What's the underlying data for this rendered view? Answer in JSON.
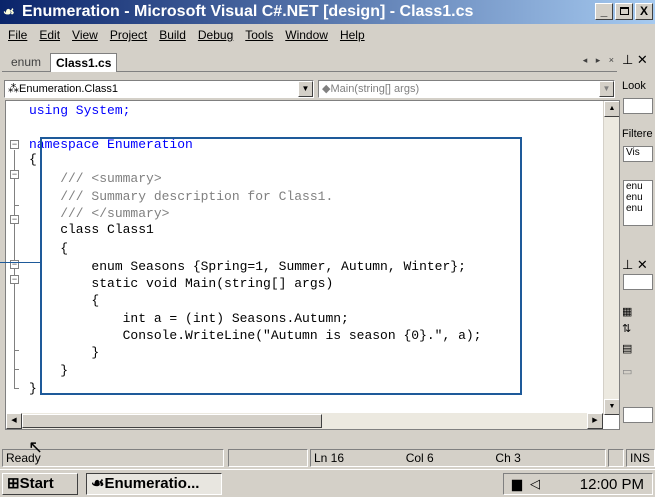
{
  "window": {
    "title": "Enumeration - Microsoft Visual C#.NET [design] - Class1.cs",
    "minimize": "_",
    "restore": " ",
    "close": "X"
  },
  "menu": [
    "File",
    "Edit",
    "View",
    "Project",
    "Build",
    "Debug",
    "Tools",
    "Window",
    "Help"
  ],
  "tabs": {
    "inactive": "enum",
    "active": "Class1.cs",
    "controls": "◂ ▸ ×"
  },
  "nav": {
    "class_dropdown": "Enumeration.Class1",
    "member_dropdown": "Main(string[] args)"
  },
  "code": [
    {
      "text": "using System;",
      "kind": "plain"
    },
    {
      "text": "",
      "kind": "plain"
    },
    {
      "text": "namespace Enumeration",
      "kind": "plain"
    },
    {
      "text": "{",
      "kind": "plain"
    },
    {
      "text": "    /// <summary>",
      "kind": "comment"
    },
    {
      "text": "    /// Summary description for Class1.",
      "kind": "comment"
    },
    {
      "text": "    /// </summary>",
      "kind": "comment"
    },
    {
      "text": "    class Class1",
      "kind": "plain"
    },
    {
      "text": "    {",
      "kind": "plain"
    },
    {
      "text": "        enum Seasons {Spring=1, Summer, Autumn, Winter};",
      "kind": "plain"
    },
    {
      "text": "        static void Main(string[] args)",
      "kind": "plain"
    },
    {
      "text": "        {",
      "kind": "plain"
    },
    {
      "text": "            int a = (int) Seasons.Autumn;",
      "kind": "plain"
    },
    {
      "text": "            Console.WriteLine(\"Autumn is season {0}.\", a);",
      "kind": "plain"
    },
    {
      "text": "        }",
      "kind": "plain"
    },
    {
      "text": "    }",
      "kind": "plain"
    },
    {
      "text": "}",
      "kind": "plain"
    }
  ],
  "side_panel": {
    "look": "Look",
    "filtered": "Filtere",
    "vis": "Vis",
    "list": [
      "enu",
      "enu",
      "enu"
    ]
  },
  "status": {
    "state": "Ready",
    "line": "Ln 16",
    "col": "Col 6",
    "ch": "Ch 3",
    "mode": "INS"
  },
  "taskbar": {
    "start": "Start",
    "task": "Enumeratio...",
    "clock": "12:00 PM"
  }
}
